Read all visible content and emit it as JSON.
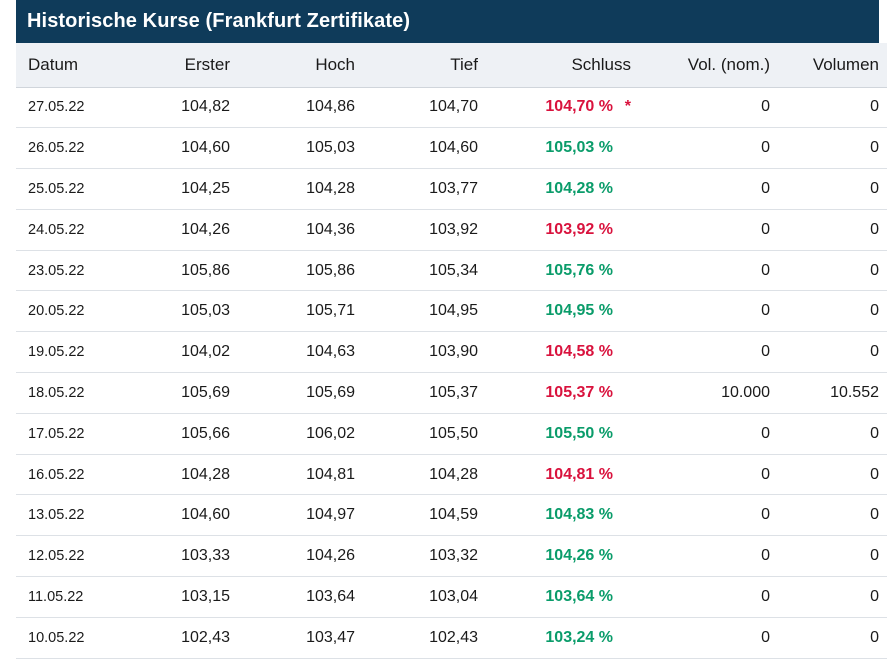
{
  "title": "Historische Kurse (Frankfurt Zertifikate)",
  "columns": [
    "Datum",
    "Erster",
    "Hoch",
    "Tief",
    "Schluss",
    "Vol. (nom.)",
    "Volumen"
  ],
  "colors": {
    "header_bg": "#0f3b5a",
    "up": "#0a9c6a",
    "down": "#d9123d"
  },
  "rows": [
    {
      "datum": "27.05.22",
      "erster": "104,82",
      "hoch": "104,86",
      "tief": "104,70",
      "schluss": "104,70 %",
      "trend": "down",
      "marker": "*",
      "vol_nom": "0",
      "volumen": "0"
    },
    {
      "datum": "26.05.22",
      "erster": "104,60",
      "hoch": "105,03",
      "tief": "104,60",
      "schluss": "105,03 %",
      "trend": "up",
      "marker": "",
      "vol_nom": "0",
      "volumen": "0"
    },
    {
      "datum": "25.05.22",
      "erster": "104,25",
      "hoch": "104,28",
      "tief": "103,77",
      "schluss": "104,28 %",
      "trend": "up",
      "marker": "",
      "vol_nom": "0",
      "volumen": "0"
    },
    {
      "datum": "24.05.22",
      "erster": "104,26",
      "hoch": "104,36",
      "tief": "103,92",
      "schluss": "103,92 %",
      "trend": "down",
      "marker": "",
      "vol_nom": "0",
      "volumen": "0"
    },
    {
      "datum": "23.05.22",
      "erster": "105,86",
      "hoch": "105,86",
      "tief": "105,34",
      "schluss": "105,76 %",
      "trend": "up",
      "marker": "",
      "vol_nom": "0",
      "volumen": "0"
    },
    {
      "datum": "20.05.22",
      "erster": "105,03",
      "hoch": "105,71",
      "tief": "104,95",
      "schluss": "104,95 %",
      "trend": "up",
      "marker": "",
      "vol_nom": "0",
      "volumen": "0"
    },
    {
      "datum": "19.05.22",
      "erster": "104,02",
      "hoch": "104,63",
      "tief": "103,90",
      "schluss": "104,58 %",
      "trend": "down",
      "marker": "",
      "vol_nom": "0",
      "volumen": "0"
    },
    {
      "datum": "18.05.22",
      "erster": "105,69",
      "hoch": "105,69",
      "tief": "105,37",
      "schluss": "105,37 %",
      "trend": "down",
      "marker": "",
      "vol_nom": "10.000",
      "volumen": "10.552"
    },
    {
      "datum": "17.05.22",
      "erster": "105,66",
      "hoch": "106,02",
      "tief": "105,50",
      "schluss": "105,50 %",
      "trend": "up",
      "marker": "",
      "vol_nom": "0",
      "volumen": "0"
    },
    {
      "datum": "16.05.22",
      "erster": "104,28",
      "hoch": "104,81",
      "tief": "104,28",
      "schluss": "104,81 %",
      "trend": "down",
      "marker": "",
      "vol_nom": "0",
      "volumen": "0"
    },
    {
      "datum": "13.05.22",
      "erster": "104,60",
      "hoch": "104,97",
      "tief": "104,59",
      "schluss": "104,83 %",
      "trend": "up",
      "marker": "",
      "vol_nom": "0",
      "volumen": "0"
    },
    {
      "datum": "12.05.22",
      "erster": "103,33",
      "hoch": "104,26",
      "tief": "103,32",
      "schluss": "104,26 %",
      "trend": "up",
      "marker": "",
      "vol_nom": "0",
      "volumen": "0"
    },
    {
      "datum": "11.05.22",
      "erster": "103,15",
      "hoch": "103,64",
      "tief": "103,04",
      "schluss": "103,64 %",
      "trend": "up",
      "marker": "",
      "vol_nom": "0",
      "volumen": "0"
    },
    {
      "datum": "10.05.22",
      "erster": "102,43",
      "hoch": "103,47",
      "tief": "102,43",
      "schluss": "103,24 %",
      "trend": "up",
      "marker": "",
      "vol_nom": "0",
      "volumen": "0"
    }
  ]
}
